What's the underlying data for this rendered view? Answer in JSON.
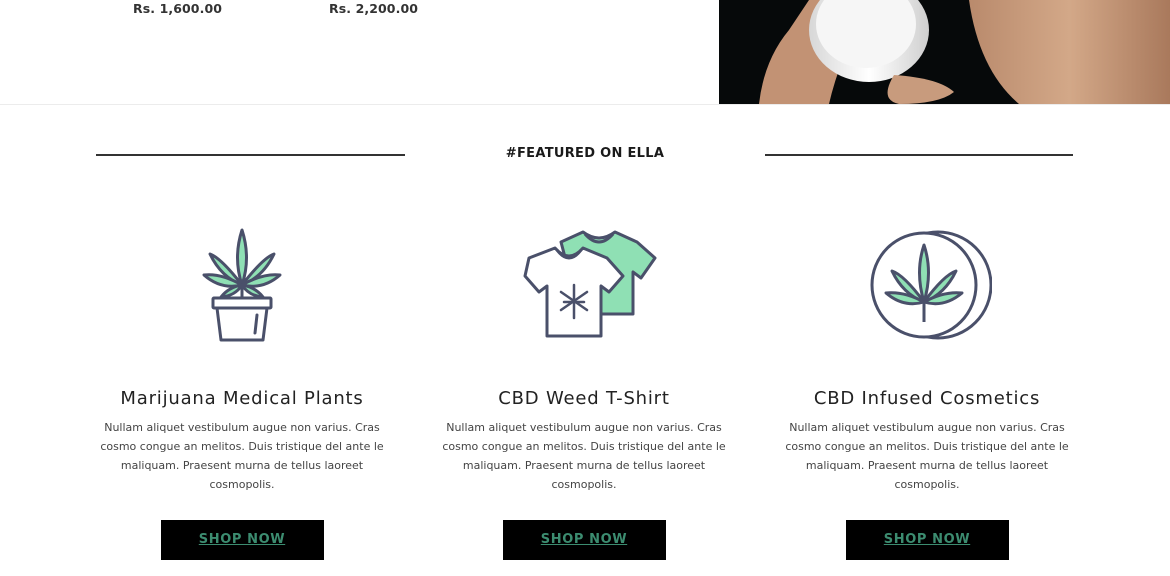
{
  "top_products": {
    "prices": [
      "Rs. 1,600.00",
      "Rs. 2,200.00"
    ]
  },
  "hero_image": {
    "alt_subject": "hand holding cosmetic cream jar"
  },
  "featured": {
    "heading": "#FEATURED ON ELLA",
    "cards": [
      {
        "icon": "potted-cannabis-plant-icon",
        "title": "Marijuana Medical Plants",
        "description": "Nullam aliquet vestibulum augue non varius. Cras cosmo congue an melitos. Duis tristique del ante le maliquam. Praesent murna de tellus laoreet cosmopolis.",
        "button": "SHOP NOW"
      },
      {
        "icon": "cannabis-tshirt-icon",
        "title": "CBD Weed T-Shirt",
        "description": "Nullam aliquet vestibulum augue non varius. Cras cosmo congue an melitos. Duis tristique del ante le maliquam. Praesent murna de tellus laoreet cosmopolis.",
        "button": "SHOP NOW"
      },
      {
        "icon": "cannabis-cosmetic-jar-icon",
        "title": "CBD Infused Cosmetics",
        "description": "Nullam aliquet vestibulum augue non varius. Cras cosmo congue an melitos. Duis tristique del ante le maliquam. Praesent murna de tellus laoreet cosmopolis.",
        "button": "SHOP NOW"
      }
    ]
  },
  "colors": {
    "accent_green": "#8fe0b4",
    "outline_navy": "#4a506a",
    "button_bg": "#000000",
    "button_text": "#3c8c70"
  }
}
